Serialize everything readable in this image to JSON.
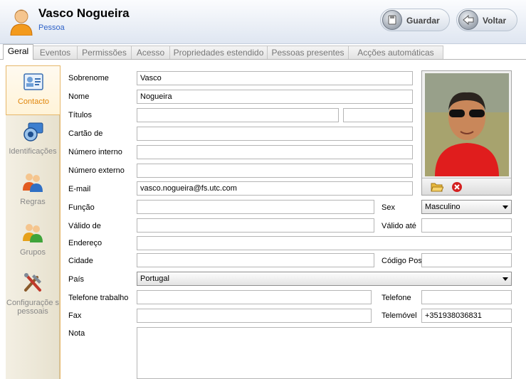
{
  "header": {
    "title": "Vasco Nogueira",
    "subtitle": "Pessoa",
    "save_label": "Guardar",
    "back_label": "Voltar"
  },
  "tabs": [
    {
      "label": "Geral",
      "active": true
    },
    {
      "label": "Eventos"
    },
    {
      "label": "Permissões"
    },
    {
      "label": "Acesso"
    },
    {
      "label": "Propriedades estendido"
    },
    {
      "label": "Pessoas presentes"
    },
    {
      "label": "Acções automáticas"
    }
  ],
  "sidebar": {
    "items": [
      {
        "label": "Contacto",
        "icon": "contact-card-icon",
        "active": true
      },
      {
        "label": "Identificações",
        "icon": "id-camera-icon"
      },
      {
        "label": "Regras",
        "icon": "users-rules-icon"
      },
      {
        "label": "Grupos",
        "icon": "users-groups-icon"
      },
      {
        "label": "Configuraçõe s pessoais",
        "icon": "tools-icon"
      }
    ]
  },
  "form": {
    "sobrenome_label": "Sobrenome",
    "sobrenome_value": "Vasco",
    "nome_label": "Nome",
    "nome_value": "Nogueira",
    "titulos_label": "Títulos",
    "titulos_value": "",
    "titulos_value2": "",
    "cartao_label": "Cartão de",
    "cartao_value": "",
    "numero_interno_label": "Número interno",
    "numero_interno_value": "",
    "numero_externo_label": "Número externo",
    "numero_externo_value": "",
    "email_label": "E-mail",
    "email_value": "vasco.nogueira@fs.utc.com",
    "funcao_label": "Função",
    "funcao_value": "",
    "sexo_label": "Sex",
    "sexo_value": "Masculino",
    "valido_de_label": "Válido de",
    "valido_de_value": "",
    "valido_ate_label": "Válido até",
    "valido_ate_value": "",
    "endereco_label": "Endereço",
    "endereco_value": "",
    "cidade_label": "Cidade",
    "cidade_value": "",
    "codigo_postal_label": "Código Post",
    "codigo_postal_value": "",
    "pais_label": "País",
    "pais_value": "Portugal",
    "telefone_trabalho_label": "Telefone trabalho",
    "telefone_trabalho_value": "",
    "telefone_label": "Telefone",
    "telefone_value": "",
    "fax_label": "Fax",
    "fax_value": "",
    "telemovel_label": "Telemóvel",
    "telemovel_value": "+351938036831",
    "nota_label": "Nota",
    "nota_value": ""
  },
  "photo": {
    "open_icon": "folder-open-icon",
    "delete_icon": "delete-icon"
  },
  "colors": {
    "accent_orange": "#e0860b",
    "subtitle_blue": "#3063c8",
    "delete_red": "#d42020"
  }
}
